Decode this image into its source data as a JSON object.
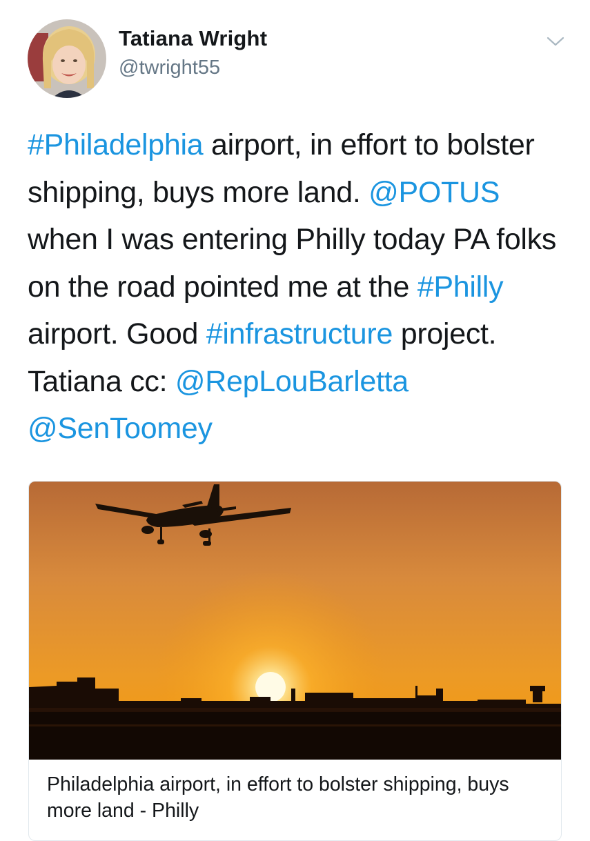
{
  "author": {
    "name": "Tatiana Wright",
    "handle": "@twright55"
  },
  "tweet": {
    "segments": [
      {
        "text": "#Philadelphia",
        "link": true
      },
      {
        "text": " airport, in effort to bolster shipping, buys more land. ",
        "link": false
      },
      {
        "text": "@POTUS",
        "link": true
      },
      {
        "text": " when I was entering Philly today PA folks on the road pointed me at the ",
        "link": false
      },
      {
        "text": "#Philly",
        "link": true
      },
      {
        "text": " airport. Good ",
        "link": false
      },
      {
        "text": "#infrastructure",
        "link": true
      },
      {
        "text": " project. Tatiana cc: ",
        "link": false
      },
      {
        "text": "@RepLouBarletta",
        "link": true
      },
      {
        "text": " ",
        "link": false
      },
      {
        "text": "@SenToomey",
        "link": true
      }
    ]
  },
  "card": {
    "caption": "Philadelphia airport, in effort to bolster shipping, buys more land - Philly"
  },
  "colors": {
    "link": "#1b95e0",
    "text": "#14171a",
    "muted": "#657786"
  },
  "icons": {
    "menu": "chevron-down-icon"
  }
}
